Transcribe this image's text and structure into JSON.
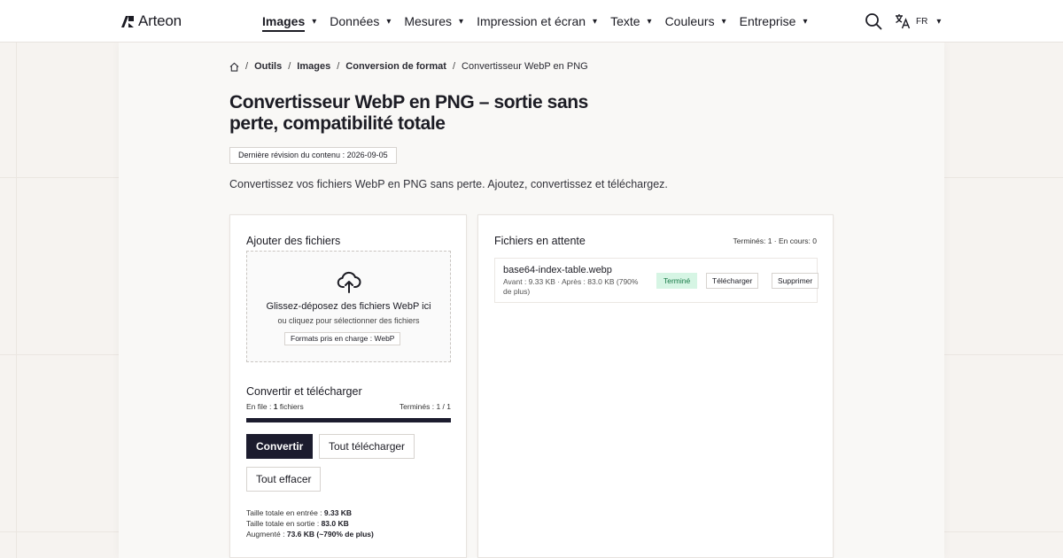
{
  "brand": {
    "name": "Arteon"
  },
  "nav": {
    "items": [
      {
        "label": "Images",
        "active": true
      },
      {
        "label": "Données"
      },
      {
        "label": "Mesures"
      },
      {
        "label": "Impression et écran"
      },
      {
        "label": "Texte"
      },
      {
        "label": "Couleurs"
      },
      {
        "label": "Entreprise"
      }
    ],
    "caret": "▾",
    "lang": "FR"
  },
  "breadcrumb": [
    "Outils",
    "Images",
    "Conversion de format",
    "Convertisseur WebP en PNG"
  ],
  "page": {
    "title": "Convertisseur WebP en PNG – sortie sans perte, compatibilité totale",
    "revision": "Dernière révision du contenu : 2026-09-05",
    "lead": "Convertissez vos fichiers WebP en PNG sans perte. Ajoutez, convertissez et téléchargez."
  },
  "add": {
    "title": "Ajouter des fichiers",
    "drop_main": "Glissez-déposez des fichiers WebP ici",
    "drop_sub": "ou cliquez pour sélectionner des fichiers",
    "formats": "Formats pris en charge : WebP"
  },
  "convert": {
    "title": "Convertir et télécharger",
    "queue_label": "En file : ",
    "queue_count": "1",
    "queue_suffix": " fichiers",
    "done": "Terminés : 1 / 1",
    "progress": 1.0,
    "btn_convert": "Convertir",
    "btn_download_all": "Tout télécharger",
    "btn_clear": "Tout effacer"
  },
  "stats": {
    "in_label": "Taille totale en entrée : ",
    "in_value": "9.33 KB",
    "out_label": "Taille totale en sortie : ",
    "out_value": "83.0 KB",
    "inc_label": "Augmenté : ",
    "inc_value": "73.6 KB (~790% de plus)"
  },
  "pending": {
    "title": "Fichiers en attente",
    "counts": "Terminés: 1 · En cours: 0",
    "files": [
      {
        "name": "base64-index-table.webp",
        "meta": "Avant : 9.33 KB · Après : 83.0 KB (790% de plus)",
        "status": "Terminé",
        "download": "Télécharger",
        "remove": "Supprimer"
      }
    ]
  },
  "colors": {
    "accent": "#1c1c2e",
    "success_bg": "#d6f5e4",
    "success_text": "#177a47"
  },
  "icons": [
    "logo-icon",
    "search-icon",
    "translate-icon",
    "home-icon",
    "upload-cloud-icon"
  ]
}
